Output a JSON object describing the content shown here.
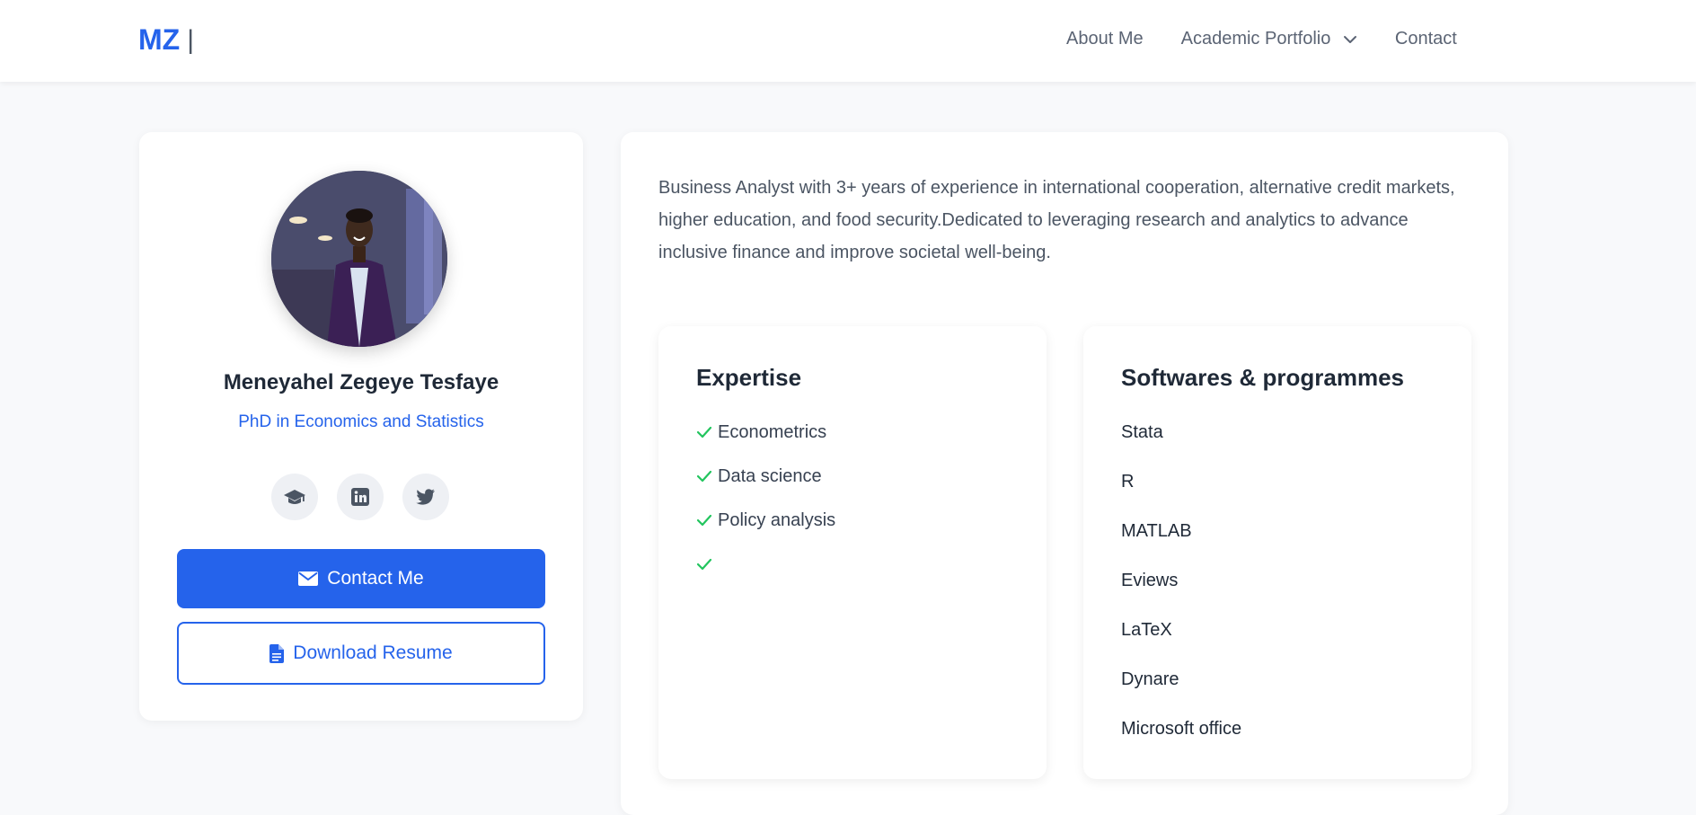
{
  "nav": {
    "brand": "MZ",
    "brand_sep": "|",
    "links": [
      {
        "label": "About Me"
      },
      {
        "label": "Academic Portfolio",
        "has_dropdown": true
      },
      {
        "label": "Contact"
      }
    ]
  },
  "profile": {
    "name": "Meneyahel Zegeye Tesfaye",
    "degree": "PhD in Economics and Statistics",
    "socials": [
      "graduation-cap-icon",
      "linkedin-icon",
      "twitter-icon"
    ],
    "contact_label": "Contact Me",
    "resume_label": "Download Resume"
  },
  "about": {
    "bio": "Business Analyst with 3+ years of experience in international cooperation, alternative credit markets, higher education, and food security.Dedicated to leveraging research and analytics to advance inclusive finance and improve societal well-being."
  },
  "expertise": {
    "title": "Expertise",
    "items": [
      "Econometrics",
      "Data science",
      "Policy analysis",
      ""
    ]
  },
  "software": {
    "title": "Softwares & programmes",
    "items": [
      "Stata",
      "R",
      "MATLAB",
      "Eviews",
      "LaTeX",
      "Dynare",
      "Microsoft office"
    ]
  },
  "colors": {
    "accent": "#2563eb",
    "check": "#22c55e",
    "page_bg": "#f8f9fb"
  }
}
